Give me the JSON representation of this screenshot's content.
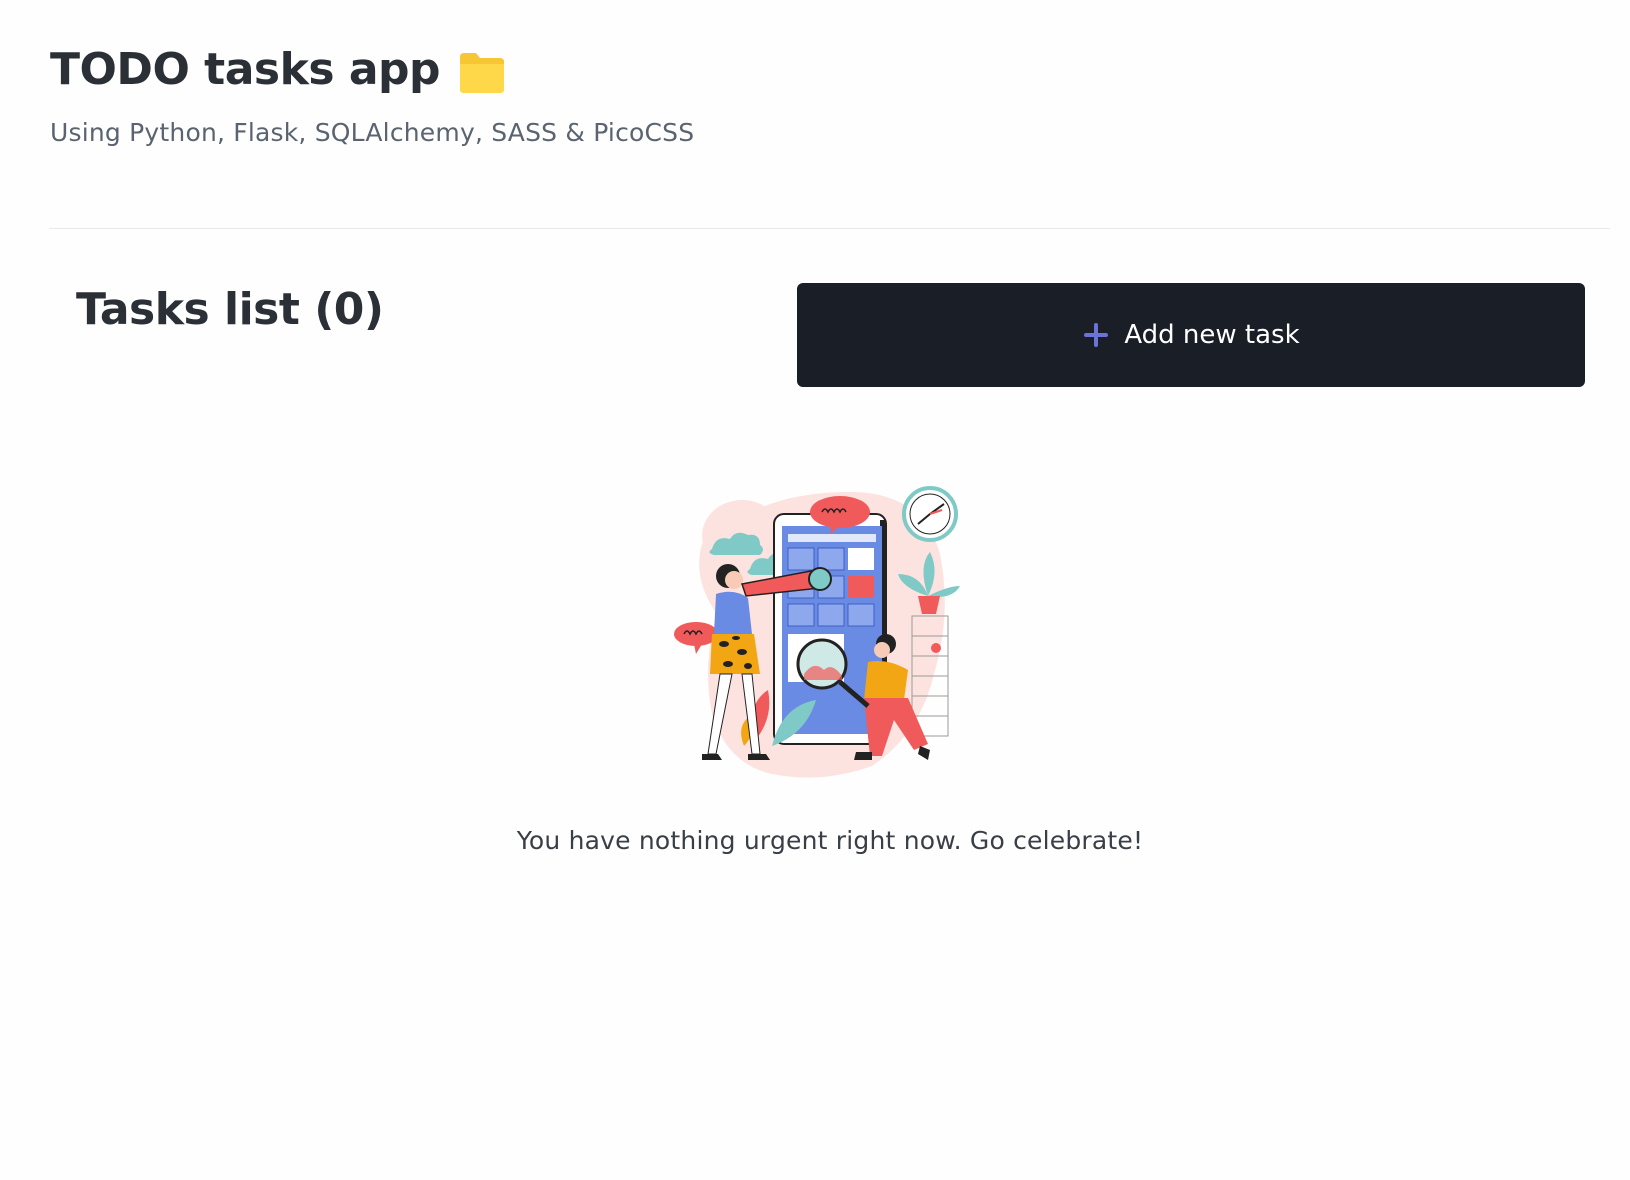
{
  "header": {
    "title": "TODO tasks app",
    "subtitle": "Using Python, Flask, SQLAlchemy, SASS & PicoCSS",
    "title_icon": "folder-icon"
  },
  "tasks": {
    "heading": "Tasks list (0)",
    "add_button_label": "Add new task",
    "add_button_icon": "plus-icon"
  },
  "empty_state": {
    "illustration": "people-searching-phone-illustration",
    "message": "You have nothing urgent right now. Go celebrate!"
  },
  "colors": {
    "button_bg": "#1a1e26",
    "plus_accent": "#6b73d8",
    "folder": "#ffd43b"
  }
}
